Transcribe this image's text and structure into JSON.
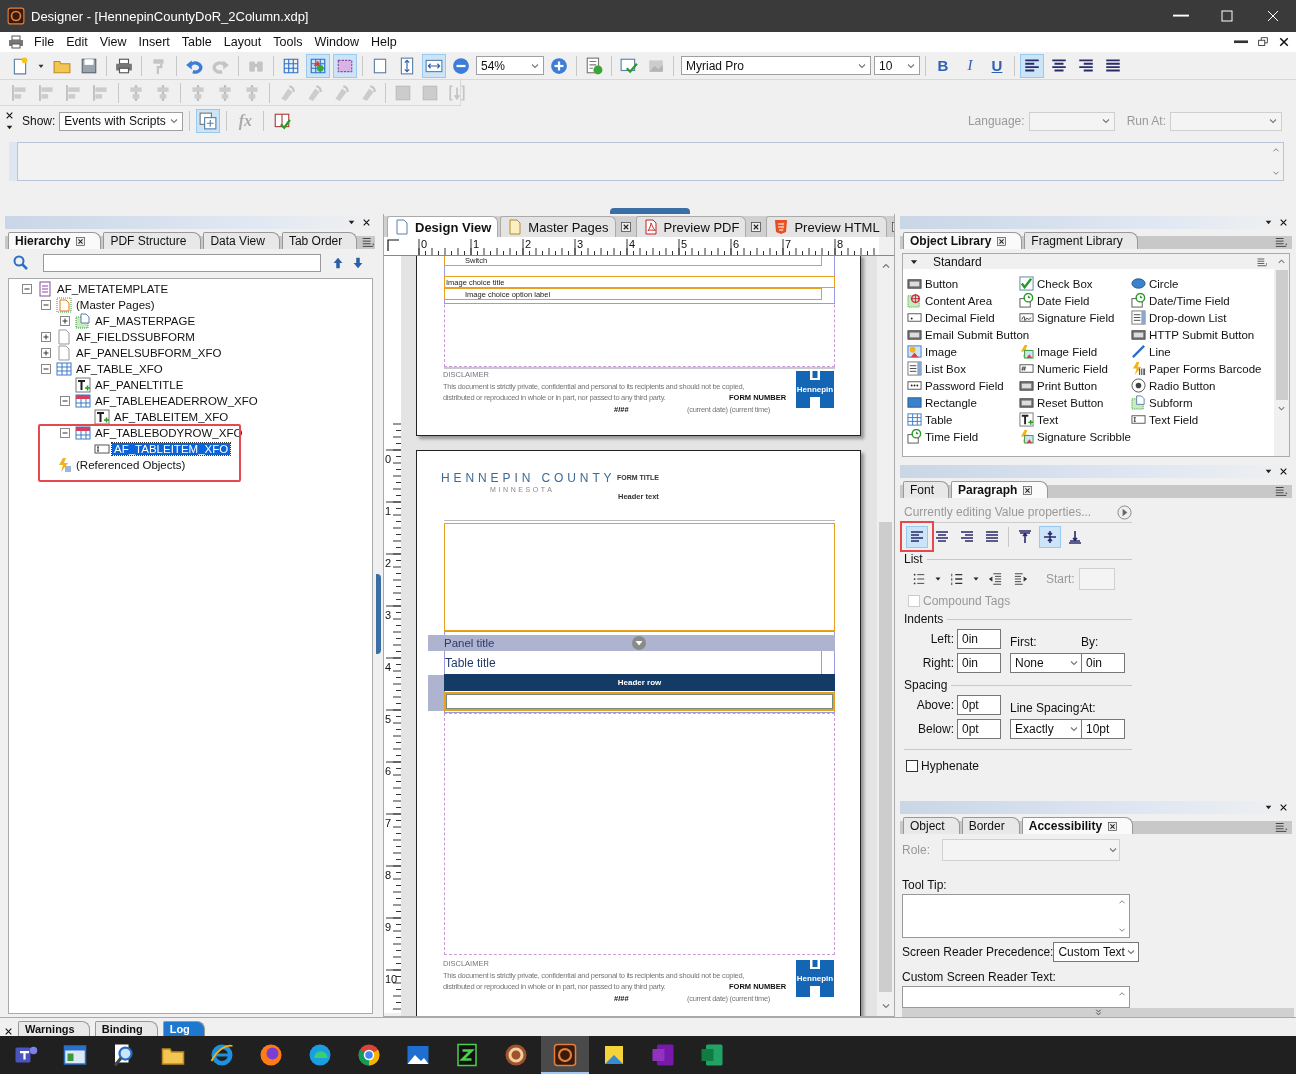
{
  "window": {
    "title": "Designer - [HennepinCountyDoR_2Column.xdp]"
  },
  "menu": [
    "File",
    "Edit",
    "View",
    "Insert",
    "Table",
    "Layout",
    "Tools",
    "Window",
    "Help"
  ],
  "toolbar": [
    {
      "kind": "new",
      "selected": false,
      "disabled": false
    },
    {
      "kind": "caret",
      "selected": false,
      "disabled": false
    },
    {
      "kind": "open",
      "selected": false,
      "disabled": false
    },
    {
      "kind": "save",
      "selected": false,
      "disabled": false
    },
    {
      "kind": "sep"
    },
    {
      "kind": "print",
      "selected": false,
      "disabled": false
    },
    {
      "kind": "sep"
    },
    {
      "kind": "painter",
      "selected": false,
      "disabled": true
    },
    {
      "kind": "sep"
    },
    {
      "kind": "undo",
      "selected": false,
      "disabled": false
    },
    {
      "kind": "redo",
      "selected": false,
      "disabled": true
    },
    {
      "kind": "sep"
    },
    {
      "kind": "find",
      "selected": false,
      "disabled": true
    },
    {
      "kind": "sep"
    },
    {
      "kind": "grid",
      "selected": false,
      "disabled": false
    },
    {
      "kind": "snap",
      "selected": true,
      "disabled": false
    },
    {
      "kind": "bounds",
      "selected": true,
      "disabled": false
    },
    {
      "kind": "sep"
    },
    {
      "kind": "fitpage",
      "selected": false,
      "disabled": false
    },
    {
      "kind": "fitheight",
      "selected": false,
      "disabled": false
    },
    {
      "kind": "fitwidth",
      "selected": true,
      "disabled": false
    },
    {
      "kind": "zoomout",
      "selected": false,
      "disabled": false
    },
    {
      "kind": "zoom-combo",
      "value": "54%"
    },
    {
      "kind": "zoomin",
      "selected": false,
      "disabled": false
    },
    {
      "kind": "sep"
    },
    {
      "kind": "checkscript",
      "selected": false,
      "disabled": false
    },
    {
      "kind": "sep"
    },
    {
      "kind": "spell",
      "selected": false,
      "disabled": false
    },
    {
      "kind": "imggrey",
      "selected": false,
      "disabled": true
    },
    {
      "kind": "sep"
    },
    {
      "kind": "font-combo",
      "value": "Myriad Pro"
    },
    {
      "kind": "size-combo",
      "value": "10"
    },
    {
      "kind": "sep"
    },
    {
      "kind": "bold",
      "label": "B",
      "selected": false,
      "disabled": false
    },
    {
      "kind": "italic",
      "label": "I",
      "selected": false,
      "disabled": false
    },
    {
      "kind": "underline",
      "label": "U",
      "selected": false,
      "disabled": false
    },
    {
      "kind": "sep"
    },
    {
      "kind": "pleft",
      "selected": true,
      "disabled": false
    },
    {
      "kind": "pcenter",
      "selected": false,
      "disabled": false
    },
    {
      "kind": "pright",
      "selected": false,
      "disabled": false
    },
    {
      "kind": "pjustify",
      "selected": false,
      "disabled": false
    }
  ],
  "layout_toolbar": [
    {
      "kind": "align",
      "disabled": true
    },
    {
      "kind": "align",
      "disabled": true
    },
    {
      "kind": "align",
      "disabled": true
    },
    {
      "kind": "align",
      "disabled": true
    },
    {
      "kind": "sep"
    },
    {
      "kind": "center",
      "disabled": true
    },
    {
      "kind": "center",
      "disabled": true
    },
    {
      "kind": "sep"
    },
    {
      "kind": "center",
      "disabled": true
    },
    {
      "kind": "center",
      "disabled": true
    },
    {
      "kind": "center",
      "disabled": true
    },
    {
      "kind": "sep"
    },
    {
      "kind": "rotate",
      "disabled": true
    },
    {
      "kind": "rotate",
      "disabled": true
    },
    {
      "kind": "rotate",
      "disabled": true
    },
    {
      "kind": "rotate",
      "disabled": true
    },
    {
      "kind": "sep"
    },
    {
      "kind": "size",
      "disabled": true
    },
    {
      "kind": "size",
      "disabled": true
    },
    {
      "kind": "brace",
      "disabled": true
    }
  ],
  "script_bar": {
    "show_label": "Show:",
    "show_value": "Events with Scripts",
    "buttons": [
      {
        "kind": "add-frames",
        "selected": true,
        "disabled": false
      },
      {
        "kind": "fx",
        "label": "fx",
        "selected": false,
        "disabled": true
      },
      {
        "kind": "check-book",
        "selected": false,
        "disabled": false
      }
    ],
    "language_label": "Language:",
    "run_at_label": "Run At:",
    "disabled": true
  },
  "hierarchy": {
    "tabs": [
      {
        "label": "Hierarchy",
        "selected": true
      },
      {
        "label": "PDF Structure",
        "selected": false
      },
      {
        "label": "Data View",
        "selected": false
      },
      {
        "label": "Tab Order",
        "selected": false
      }
    ],
    "tree": [
      {
        "label": "AF_METATEMPLATE",
        "kind": "form",
        "expanded": true,
        "selected": false,
        "children": [
          {
            "label": "(Master Pages)",
            "kind": "master",
            "expanded": true,
            "selected": false,
            "children": [
              {
                "label": "AF_MASTERPAGE",
                "kind": "subform",
                "expandable": true,
                "selected": false
              }
            ]
          },
          {
            "label": "AF_FIELDSSUBFORM",
            "kind": "blank",
            "expandable": true,
            "selected": false
          },
          {
            "label": "AF_PANELSUBFORM_XFO",
            "kind": "blank",
            "expandable": true,
            "selected": false
          },
          {
            "label": "AF_TABLE_XFO",
            "kind": "table",
            "expanded": true,
            "selected": false,
            "children": [
              {
                "label": "AF_PANELTITLE",
                "kind": "text",
                "selected": false
              },
              {
                "label": "AF_TABLEHEADERROW_XFO",
                "kind": "tablerow",
                "expanded": true,
                "selected": false,
                "children": [
                  {
                    "label": "AF_TABLEITEM_XFO",
                    "kind": "text",
                    "selected": false
                  }
                ]
              },
              {
                "label": "AF_TABLEBODYROW_XFO",
                "kind": "tablerow",
                "expanded": true,
                "selected": false,
                "highlighted": true,
                "children": [
                  {
                    "label": "AF_TABLEITEM_XFO",
                    "kind": "textfield",
                    "selected": true
                  }
                ]
              }
            ]
          },
          {
            "label": "(Referenced Objects)",
            "kind": "referenced",
            "selected": false
          }
        ]
      }
    ]
  },
  "design": {
    "tabs": [
      {
        "label": "Design View",
        "kind": "page",
        "selected": true,
        "closable": false
      },
      {
        "label": "Master Pages",
        "kind": "masterdoc",
        "selected": false,
        "closable": true
      },
      {
        "label": "Preview PDF",
        "kind": "pdf",
        "selected": false,
        "closable": true
      },
      {
        "label": "Preview HTML",
        "kind": "html",
        "selected": false,
        "closable": true
      }
    ],
    "ruler_h": [
      "0",
      "1",
      "2",
      "3",
      "4",
      "5",
      "6",
      "7",
      "8"
    ],
    "ruler_v": [
      "0",
      "1",
      "2",
      "3",
      "4",
      "5",
      "6",
      "7",
      "8",
      "9",
      "10"
    ],
    "page1": {
      "switch_label": "Switch",
      "choice_title": "Image choice title",
      "choice_option": "Image choice option label",
      "footer": {
        "disclaimer_title": "DISCLAIMER",
        "disclaimer_lines": [
          "This document is strictly private, confidential and personal to its recipients and should not be copied,",
          "distributed or reproduced in whole or in part, nor passed to any third party."
        ],
        "form_number": "FORM NUMBER",
        "date_time": "(current date) (current time)",
        "page_number": "#/##",
        "logo_text": "Hennepin"
      }
    },
    "page2": {
      "org": "HENNEPIN COUNTY",
      "state": "MINNESOTA",
      "form_title": "FORM TITLE",
      "header_text": "Header text",
      "panel_title": "Panel title",
      "table_title": "Table title",
      "header_row": "Header row",
      "footer": {
        "disclaimer_title": "DISCLAIMER",
        "disclaimer_lines": [
          "This document is strictly private, confidential and personal to its recipients and should not be copied,",
          "distributed or reproduced in whole or in part, nor passed to any third party."
        ],
        "form_number": "FORM NUMBER",
        "date_time": "(current date) (current time)",
        "page_number": "#/##",
        "logo_text": "Hennepin"
      }
    }
  },
  "object_library": {
    "tabs": [
      {
        "label": "Object Library",
        "selected": true
      },
      {
        "label": "Fragment Library",
        "selected": false
      }
    ],
    "section": "Standard",
    "expanded": true,
    "items": [
      {
        "label": "Button",
        "kind": "ok"
      },
      {
        "label": "Check Box",
        "kind": "checkbox"
      },
      {
        "label": "Circle",
        "kind": "circle"
      },
      {
        "label": "Content Area",
        "kind": "content"
      },
      {
        "label": "Date Field",
        "kind": "date"
      },
      {
        "label": "Date/Time Field",
        "kind": "date"
      },
      {
        "label": "Decimal Field",
        "kind": "decimal"
      },
      {
        "label": "Signature Field",
        "kind": "signature"
      },
      {
        "label": "Drop-down List",
        "kind": "dropdown"
      },
      {
        "label": "Email Submit Button",
        "kind": "ok"
      },
      {
        "label": "HTTP Submit Button",
        "kind": "ok"
      },
      {
        "label": "Image",
        "kind": "image"
      },
      {
        "label": "Image Field",
        "kind": "imagefield"
      },
      {
        "label": "Line",
        "kind": "line"
      },
      {
        "label": "List Box",
        "kind": "dropdown"
      },
      {
        "label": "Numeric Field",
        "kind": "numeric"
      },
      {
        "label": "Paper Forms Barcode",
        "kind": "barcode"
      },
      {
        "label": "Password Field",
        "kind": "password"
      },
      {
        "label": "Print Button",
        "kind": "ok"
      },
      {
        "label": "Radio Button",
        "kind": "radio"
      },
      {
        "label": "Rectangle",
        "kind": "rectangle"
      },
      {
        "label": "Reset Button",
        "kind": "ok"
      },
      {
        "label": "Subform",
        "kind": "subform"
      },
      {
        "label": "Table",
        "kind": "table"
      },
      {
        "label": "Text",
        "kind": "text"
      },
      {
        "label": "Text Field",
        "kind": "textfield"
      },
      {
        "label": "Time Field",
        "kind": "date"
      },
      {
        "label": "Signature Scribble",
        "kind": "imagefield"
      }
    ]
  },
  "paragraph": {
    "tabs": [
      {
        "label": "Font",
        "selected": false
      },
      {
        "label": "Paragraph",
        "selected": true
      }
    ],
    "note": "Currently editing Value properties...",
    "halign": [
      {
        "kind": "pleft",
        "selected": true,
        "highlighted": true
      },
      {
        "kind": "pcenter",
        "selected": false
      },
      {
        "kind": "pright",
        "selected": false
      },
      {
        "kind": "pjustify",
        "selected": false
      }
    ],
    "valign": [
      {
        "kind": "vtop",
        "selected": false
      },
      {
        "kind": "vmiddle",
        "selected": true
      },
      {
        "kind": "vbottom",
        "selected": false
      }
    ],
    "list_label": "List",
    "start_label": "Start:",
    "compound": {
      "label": "Compound Tags",
      "checked": false,
      "disabled": true
    },
    "indents": {
      "title": "Indents",
      "left_label": "Left:",
      "left": "0in",
      "first_label": "First:",
      "first": "None",
      "by_label": "By:",
      "by": "0in",
      "right_label": "Right:",
      "right": "0in"
    },
    "spacing": {
      "title": "Spacing",
      "above_label": "Above:",
      "above": "0pt",
      "line_label": "Line Spacing:",
      "line": "Exactly",
      "at_label": "At:",
      "at": "10pt",
      "below_label": "Below:",
      "below": "0pt"
    },
    "hyphenate": {
      "label": "Hyphenate",
      "checked": false
    }
  },
  "accessibility": {
    "tabs": [
      {
        "label": "Object",
        "selected": false
      },
      {
        "label": "Border",
        "selected": false
      },
      {
        "label": "Accessibility",
        "selected": true
      }
    ],
    "role_label": "Role:",
    "tooltip_label": "Tool Tip:",
    "precedence_label": "Screen Reader Precedence:",
    "precedence": "Custom Text",
    "custom_label": "Custom Screen Reader Text:"
  },
  "bottom_tabs": [
    {
      "label": "Warnings",
      "selected": false
    },
    {
      "label": "Binding",
      "selected": false
    },
    {
      "label": "Log",
      "selected": true
    }
  ],
  "taskbar": [
    {
      "kind": "teams",
      "selected": false
    },
    {
      "kind": "window",
      "selected": false
    },
    {
      "kind": "tsearch",
      "selected": false
    },
    {
      "kind": "open",
      "selected": false
    },
    {
      "kind": "ie",
      "selected": false
    },
    {
      "kind": "firefox",
      "selected": false
    },
    {
      "kind": "edge",
      "selected": false
    },
    {
      "kind": "chrome",
      "selected": false
    },
    {
      "kind": "photos",
      "selected": false
    },
    {
      "kind": "green",
      "selected": false
    },
    {
      "kind": "gear",
      "selected": false
    },
    {
      "kind": "designer",
      "selected": true
    },
    {
      "kind": "sticky",
      "selected": false
    },
    {
      "kind": "onenote",
      "selected": false
    },
    {
      "kind": "excel",
      "selected": false
    }
  ]
}
